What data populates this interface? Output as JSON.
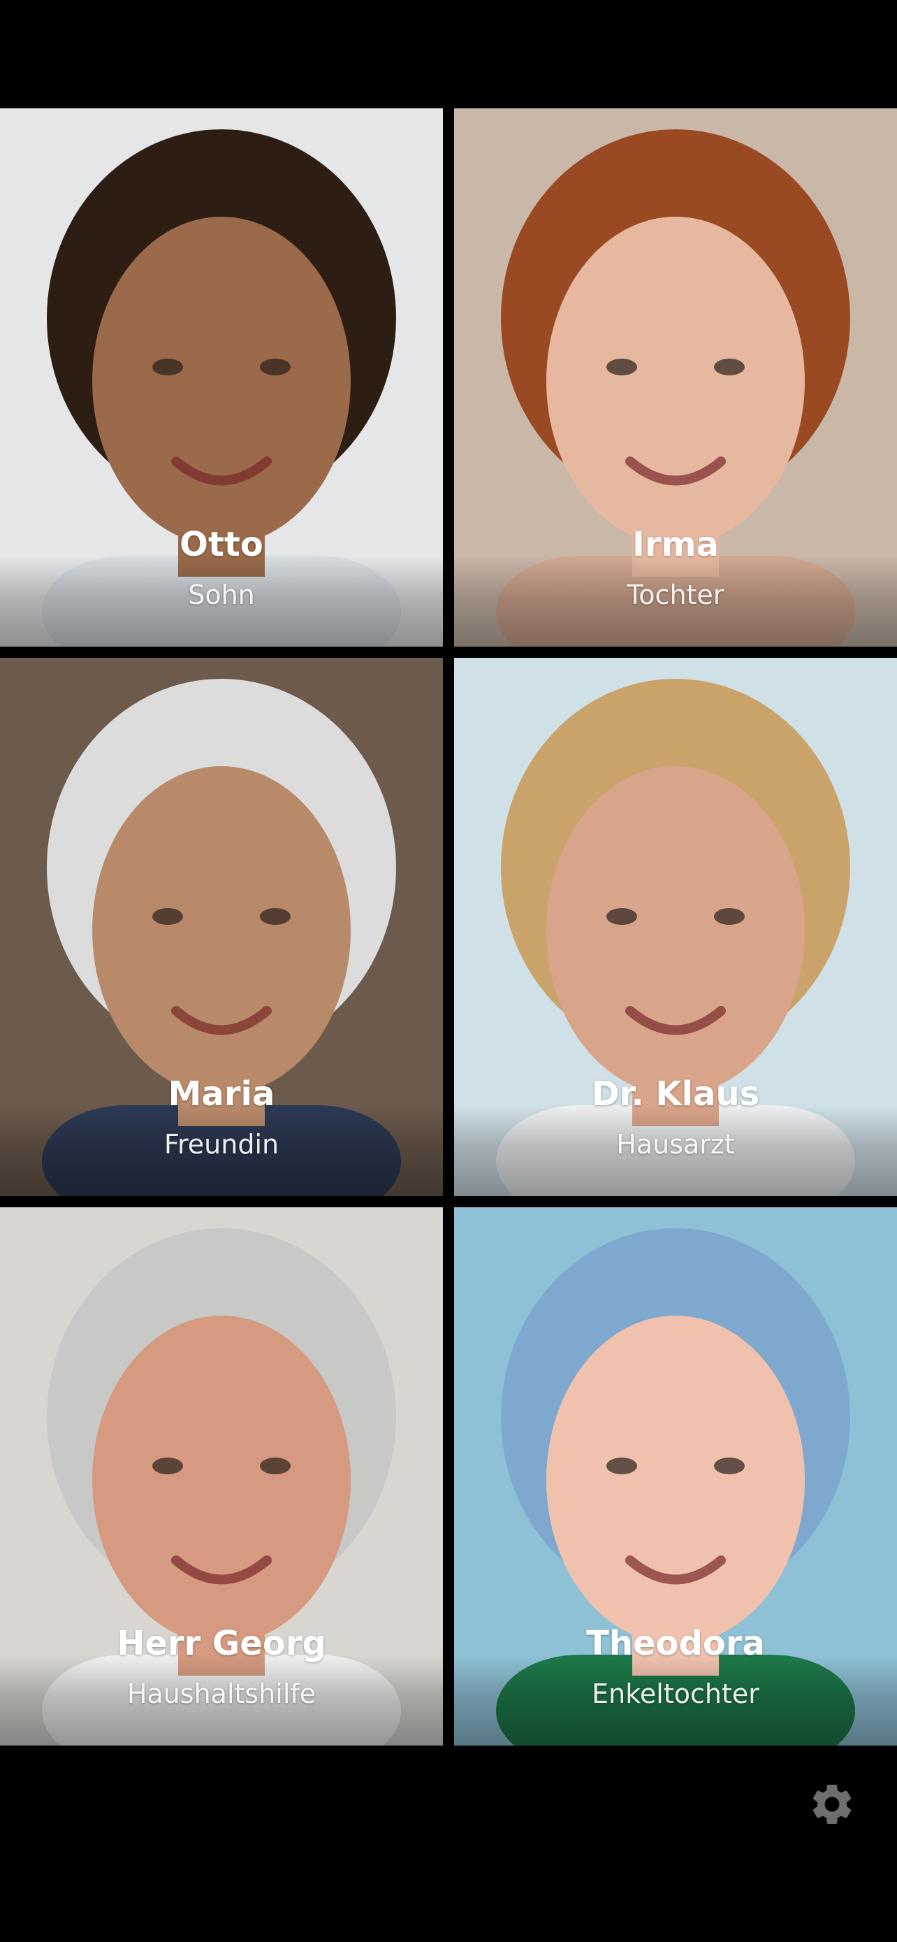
{
  "contacts": [
    {
      "name": "Otto",
      "role": "Sohn",
      "bg": "#e4e6e8",
      "skin": "#9a6a4a",
      "hair": "#2d1e14",
      "shirt": "#d8dde2"
    },
    {
      "name": "Irma",
      "role": "Tochter",
      "bg": "#c9b7a8",
      "skin": "#e7b8a0",
      "hair": "#9a4a22",
      "shirt": "#d2a890"
    },
    {
      "name": "Maria",
      "role": "Freundin",
      "bg": "#6c5a4c",
      "skin": "#b98a6a",
      "hair": "#dcdcdc",
      "shirt": "#2d3a55"
    },
    {
      "name": "Dr. Klaus",
      "role": "Hausarzt",
      "bg": "#cfe0e6",
      "skin": "#d9a58a",
      "hair": "#c9a36a",
      "shirt": "#eef0f2"
    },
    {
      "name": "Herr Georg",
      "role": "Haushaltshilfe",
      "bg": "#d9d6d2",
      "skin": "#d59a80",
      "hair": "#c8c8c6",
      "shirt": "#f0f0f0"
    },
    {
      "name": "Theodora",
      "role": "Enkeltochter",
      "bg": "#8fc1d6",
      "skin": "#f0c2ae",
      "hair": "#7fa8cf",
      "shirt": "#1e7a4a"
    }
  ],
  "settings_icon": "gear-icon",
  "colors": {
    "background": "#000000",
    "label": "#ffffff",
    "gear": "#6e6e6e"
  }
}
